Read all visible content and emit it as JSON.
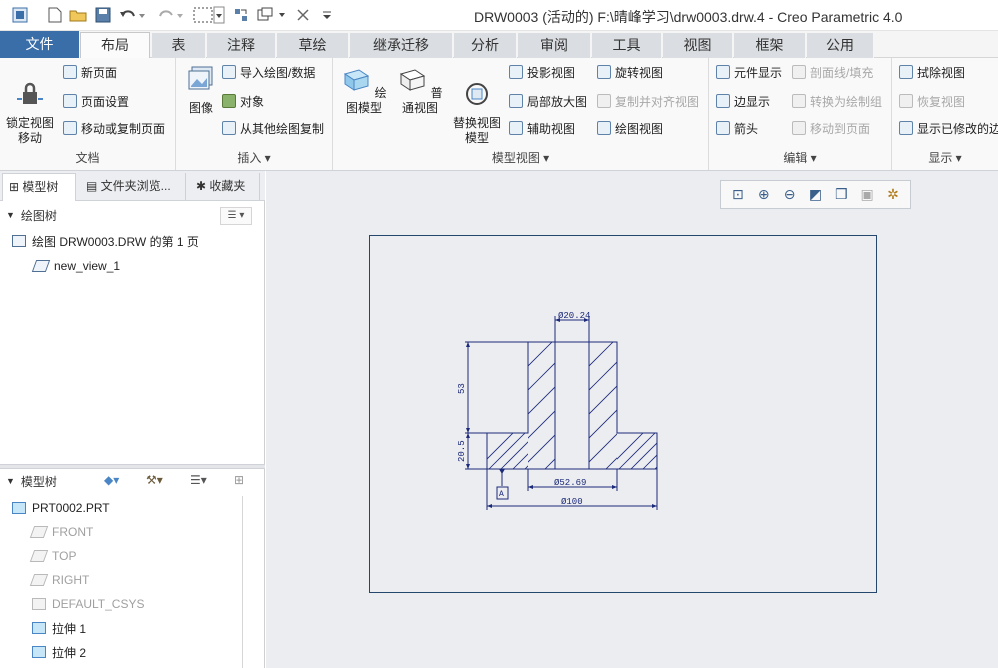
{
  "window": {
    "title": "DRW0003 (活动的) F:\\晴峰学习\\drw0003.drw.4 - Creo Parametric 4.0"
  },
  "menu": {
    "tabs": [
      "文件",
      "布局",
      "表",
      "注释",
      "草绘",
      "继承迁移",
      "分析",
      "审阅",
      "工具",
      "视图",
      "框架",
      "公用"
    ],
    "active": "布局"
  },
  "ribbon": {
    "document": {
      "label": "文档",
      "lock_view_move": "锁定视图\n移动",
      "new_page": "新页面",
      "page_setup": "页面设置",
      "move_copy_page": "移动或复制页面"
    },
    "insert": {
      "label": "插入",
      "image": "图像",
      "import_drawing": "导入绘图/数据",
      "object": "对象",
      "copy_from_drawing": "从其他绘图复制"
    },
    "model_views": {
      "label": "模型视图",
      "drawing_model": "绘图模型",
      "general_view": "普通视图",
      "replace_view_model": "替换视图\n模型",
      "projection_view": "投影视图",
      "detailed_view": "局部放大图",
      "auxiliary_view": "辅助视图",
      "revolved_view": "旋转视图",
      "copy_align_view": "复制并对齐视图",
      "drawing_view": "绘图视图"
    },
    "edit": {
      "label": "编辑",
      "component_display": "元件显示",
      "edge_display": "边显示",
      "arrow": "箭头",
      "xhatch": "剖面线/填充",
      "convert_to_draft": "转换为绘制组",
      "move_to_page": "移动到页面"
    },
    "display": {
      "label": "显示",
      "erase_view": "拭除视图",
      "resume_view": "恢复视图",
      "show_modified": "显示已修改的边"
    }
  },
  "panel": {
    "tabs": [
      "模型树",
      "文件夹浏览...",
      "收藏夹"
    ],
    "drawing_tree": {
      "title": "绘图树",
      "items": [
        "绘图 DRW0003.DRW 的第 1 页",
        "new_view_1"
      ]
    },
    "model_tree": {
      "title": "模型树",
      "items": [
        "PRT0002.PRT",
        "FRONT",
        "TOP",
        "RIGHT",
        "DEFAULT_CSYS",
        "拉伸 1",
        "拉伸 2"
      ]
    }
  },
  "drawing": {
    "dims": [
      "Ø20.24",
      "53",
      "20.5",
      "Ø52.69",
      "Ø100"
    ],
    "datum": "A"
  },
  "colors": {
    "file_tab": "#3a6ea8",
    "sheet_border": "#24476e",
    "geometry": "#1c2a7a"
  }
}
